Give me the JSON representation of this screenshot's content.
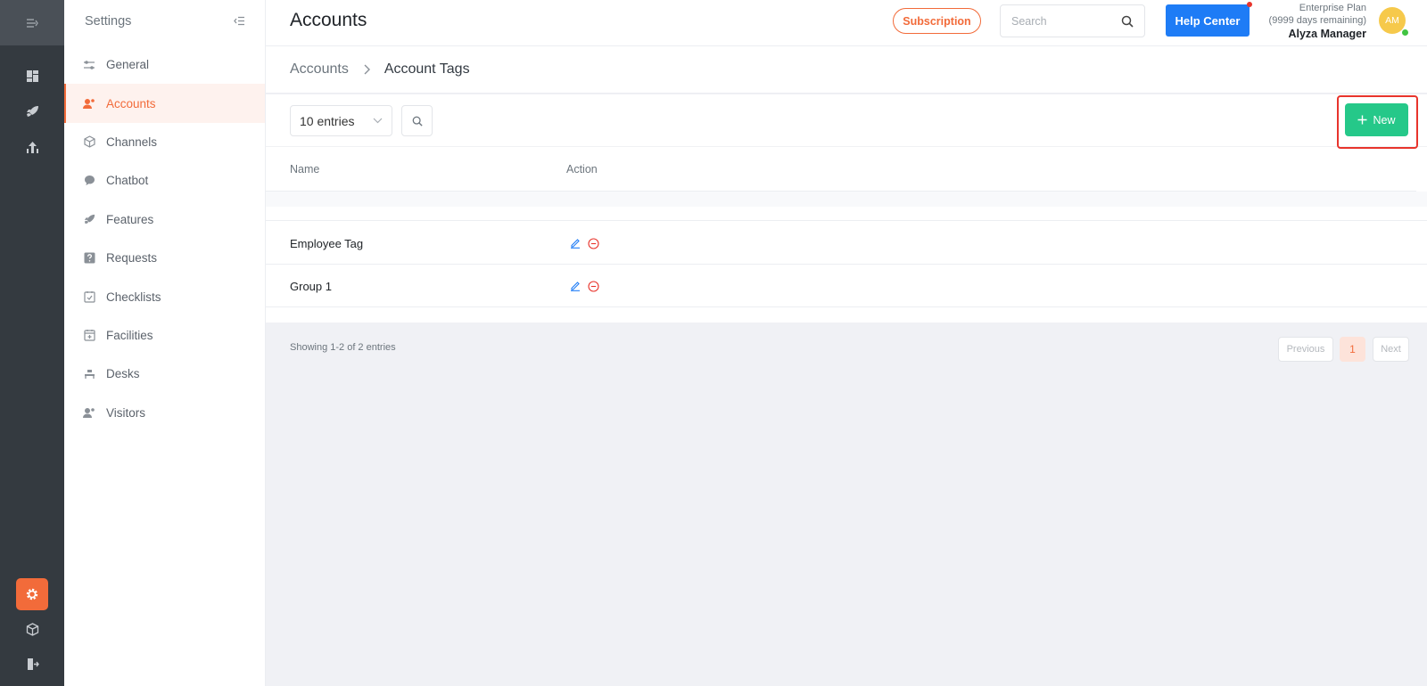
{
  "rail": {
    "items": [
      "menu-toggle-icon",
      "dashboard-icon",
      "rocket-icon",
      "analytics-icon",
      "settings-icon",
      "box-icon",
      "logout-icon"
    ]
  },
  "sidebar": {
    "title": "Settings",
    "items": [
      {
        "label": "General",
        "icon": "sliders-icon"
      },
      {
        "label": "Accounts",
        "icon": "users-icon",
        "active": true
      },
      {
        "label": "Channels",
        "icon": "cube-icon"
      },
      {
        "label": "Chatbot",
        "icon": "chat-icon"
      },
      {
        "label": "Features",
        "icon": "rocket-icon"
      },
      {
        "label": "Requests",
        "icon": "question-icon"
      },
      {
        "label": "Checklists",
        "icon": "checklist-icon"
      },
      {
        "label": "Facilities",
        "icon": "calendar-plus-icon"
      },
      {
        "label": "Desks",
        "icon": "desk-icon"
      },
      {
        "label": "Visitors",
        "icon": "visitor-icon"
      }
    ]
  },
  "header": {
    "title": "Accounts",
    "subscription_label": "Subscription",
    "search_placeholder": "Search",
    "help_label": "Help Center",
    "plan_name": "Enterprise Plan",
    "plan_days": "(9999 days remaining)",
    "user_name": "Alyza Manager",
    "avatar_initials": "AM"
  },
  "breadcrumb": {
    "parent": "Accounts",
    "current": "Account Tags"
  },
  "toolbar": {
    "entries_label": "10 entries",
    "new_label": "New"
  },
  "table": {
    "columns": [
      "Name",
      "Action"
    ],
    "rows": [
      {
        "name": "Employee Tag"
      },
      {
        "name": "Group 1"
      }
    ]
  },
  "footer": {
    "showing": "Showing 1-2 of 2 entries",
    "prev_label": "Previous",
    "current_page": "1",
    "next_label": "Next"
  },
  "colors": {
    "accent": "#f26b3a",
    "primary": "#1e7cf6",
    "success": "#25c889",
    "highlight": "#e8342c",
    "rail_bg": "#343a40"
  }
}
